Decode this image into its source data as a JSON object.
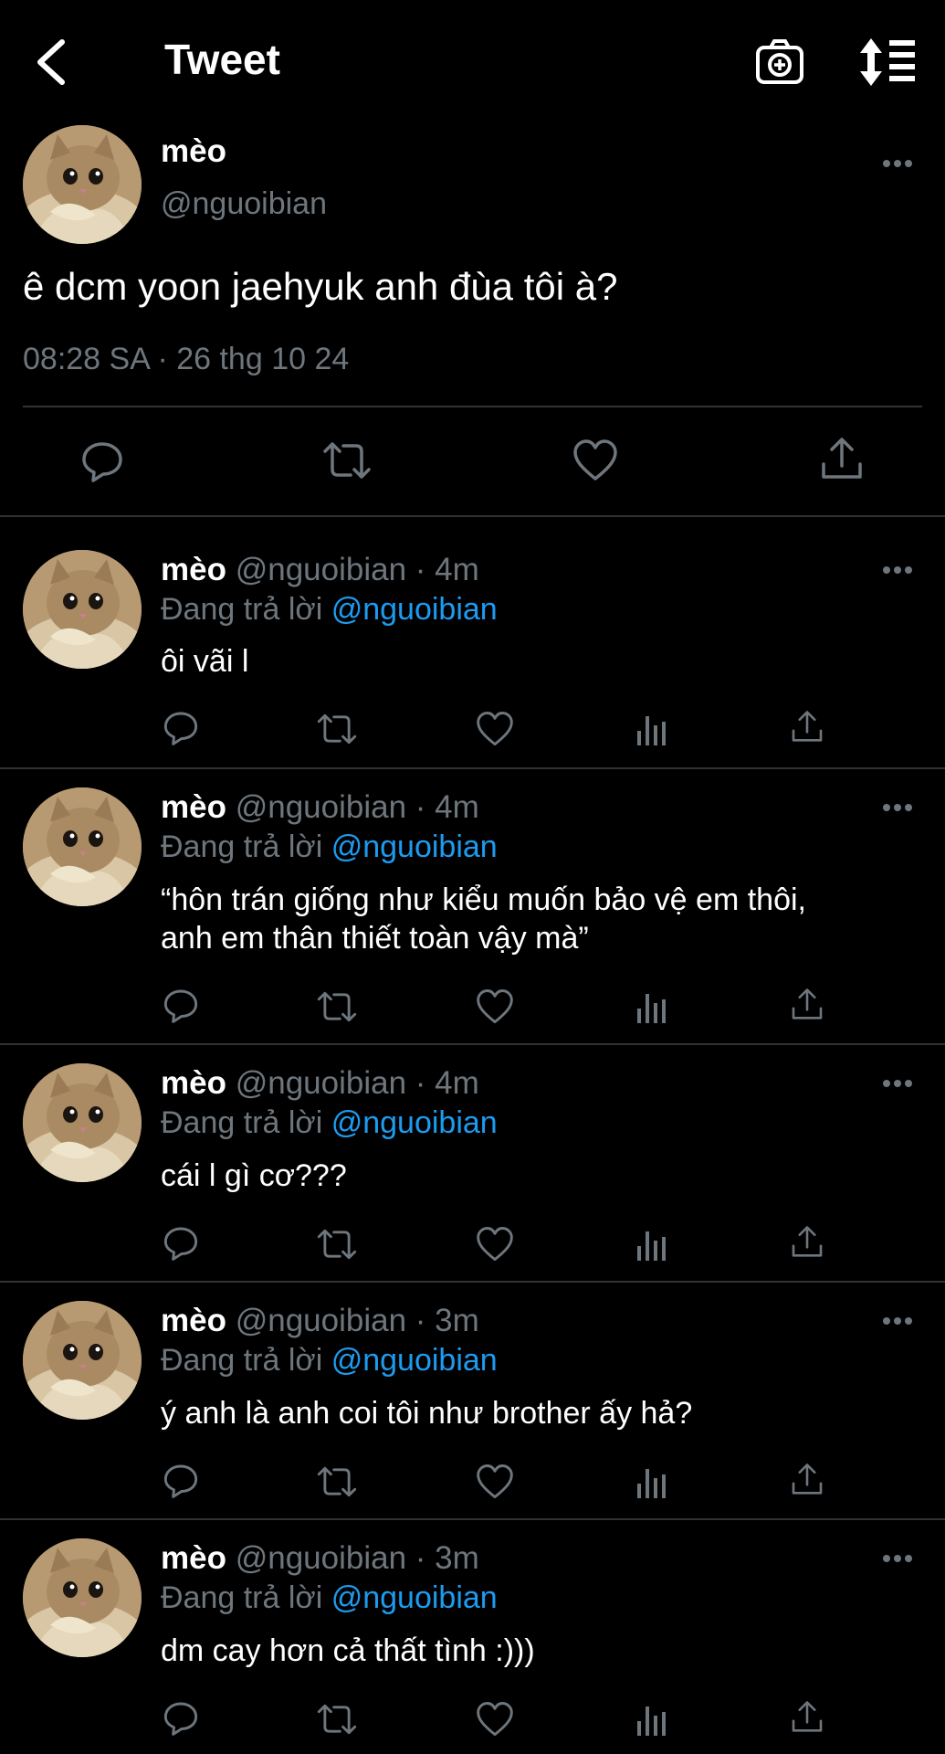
{
  "header": {
    "title": "Tweet"
  },
  "main_tweet": {
    "name": "mèo",
    "handle": "@nguoibian",
    "text": "ê dcm yoon jaehyuk anh đùa tôi à?",
    "timestamp": "08:28 SA · 26 thg 10 24"
  },
  "reply_label": "Đang trả lời",
  "replies": [
    {
      "name": "mèo",
      "meta": "@nguoibian · 4m",
      "reply_to": "@nguoibian",
      "text": "ôi vãi l"
    },
    {
      "name": "mèo",
      "meta": "@nguoibian · 4m",
      "reply_to": "@nguoibian",
      "text_line1": "“hôn trán giống như kiểu muốn bảo vệ em thôi,",
      "text_line2": "anh em thân thiết toàn vậy mà”"
    },
    {
      "name": "mèo",
      "meta": "@nguoibian · 4m",
      "reply_to": "@nguoibian",
      "text": "cái l gì cơ???"
    },
    {
      "name": "mèo",
      "meta": "@nguoibian · 3m",
      "reply_to": "@nguoibian",
      "text": "ý anh là anh coi tôi như brother ấy hả?"
    },
    {
      "name": "mèo",
      "meta": "@nguoibian · 3m",
      "reply_to": "@nguoibian",
      "text": "dm cay hơn cả thất tình :)))"
    }
  ],
  "colors": {
    "background": "#000000",
    "muted": "#6e767d",
    "link": "#1d9bf0",
    "divider": "#2f3336"
  }
}
